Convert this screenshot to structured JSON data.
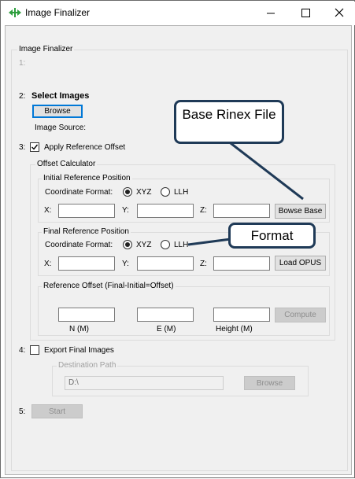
{
  "window": {
    "title": "Image Finalizer",
    "icon": "green-arrows-icon",
    "minimize": "—",
    "maximize": "☐",
    "close": "✕"
  },
  "form": {
    "group_title": "Image Finalizer",
    "step1": {
      "num": "1:"
    },
    "step2": {
      "num": "2:",
      "title": "Select Images",
      "browse": "Browse",
      "image_source": "Image Source:"
    },
    "step3": {
      "num": "3:",
      "checkbox_label": "Apply Reference Offset",
      "checked": true
    },
    "offset": {
      "title": "Offset Calculator",
      "initial": {
        "title": "Initial Reference Position",
        "format_label": "Coordinate Format:",
        "xyz": "XYZ",
        "llh": "LLH",
        "selected": "XYZ",
        "x": "X:",
        "y": "Y:",
        "z": "Z:",
        "button": "Bowse Base"
      },
      "final": {
        "title": "Final Reference Position",
        "format_label": "Coordinate Format:",
        "xyz": "XYZ",
        "llh": "LLH",
        "selected": "XYZ",
        "x": "X:",
        "y": "Y:",
        "z": "Z:",
        "button": "Load OPUS"
      },
      "ref": {
        "title": "Reference Offset (Final-Initial=Offset)",
        "n": "N (M)",
        "e": "E (M)",
        "h": "Height (M)",
        "compute": "Compute"
      }
    },
    "step4": {
      "num": "4:",
      "checkbox_label": "Export Final Images",
      "checked": false,
      "dest_title": "Destination Path",
      "path": "D:\\",
      "browse": "Browse"
    },
    "step5": {
      "num": "5:",
      "start": "Start"
    }
  },
  "annotations": {
    "callout1": "Base Rinex File",
    "callout2": "Format"
  },
  "colors": {
    "callout_border": "#1f3a57",
    "accent": "#0078d7",
    "icon_green": "#2e9e3e"
  }
}
